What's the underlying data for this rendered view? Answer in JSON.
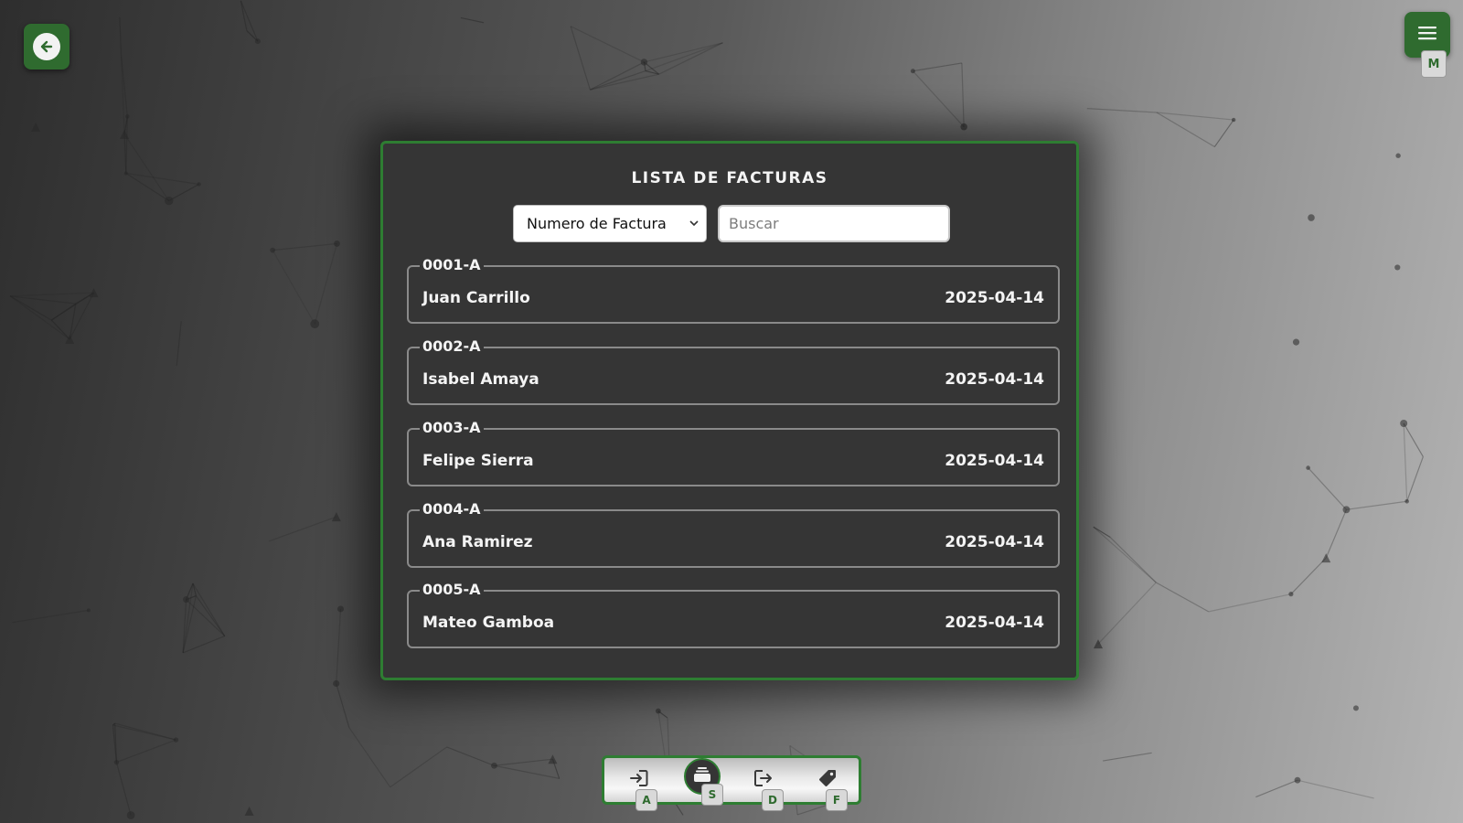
{
  "colors": {
    "accent": "#2e7d32",
    "button_green": "#2f6b2f",
    "panel_bg": "#353535",
    "text": "#f4f4f4"
  },
  "header": {
    "back_icon": "arrow-left-icon",
    "menu_icon": "hamburger-menu-icon",
    "menu_shortcut": "M"
  },
  "invoices_panel": {
    "title": "LISTA DE FACTURAS",
    "filter": {
      "selected": "Numero de Factura"
    },
    "search": {
      "placeholder": "Buscar",
      "value": ""
    },
    "invoices": [
      {
        "number": "0001-A",
        "client": "Juan Carrillo",
        "date": "2025-04-14"
      },
      {
        "number": "0002-A",
        "client": "Isabel Amaya",
        "date": "2025-04-14"
      },
      {
        "number": "0003-A",
        "client": "Felipe Sierra",
        "date": "2025-04-14"
      },
      {
        "number": "0004-A",
        "client": "Ana Ramirez",
        "date": "2025-04-14"
      },
      {
        "number": "0005-A",
        "client": "Mateo Gamboa",
        "date": "2025-04-14"
      }
    ]
  },
  "bottom_nav": {
    "items": [
      {
        "icon": "login-icon",
        "shortcut": "A",
        "active": false
      },
      {
        "icon": "stack-icon",
        "shortcut": "S",
        "active": true
      },
      {
        "icon": "logout-icon",
        "shortcut": "D",
        "active": false
      },
      {
        "icon": "tag-icon",
        "shortcut": "F",
        "active": false
      }
    ]
  }
}
